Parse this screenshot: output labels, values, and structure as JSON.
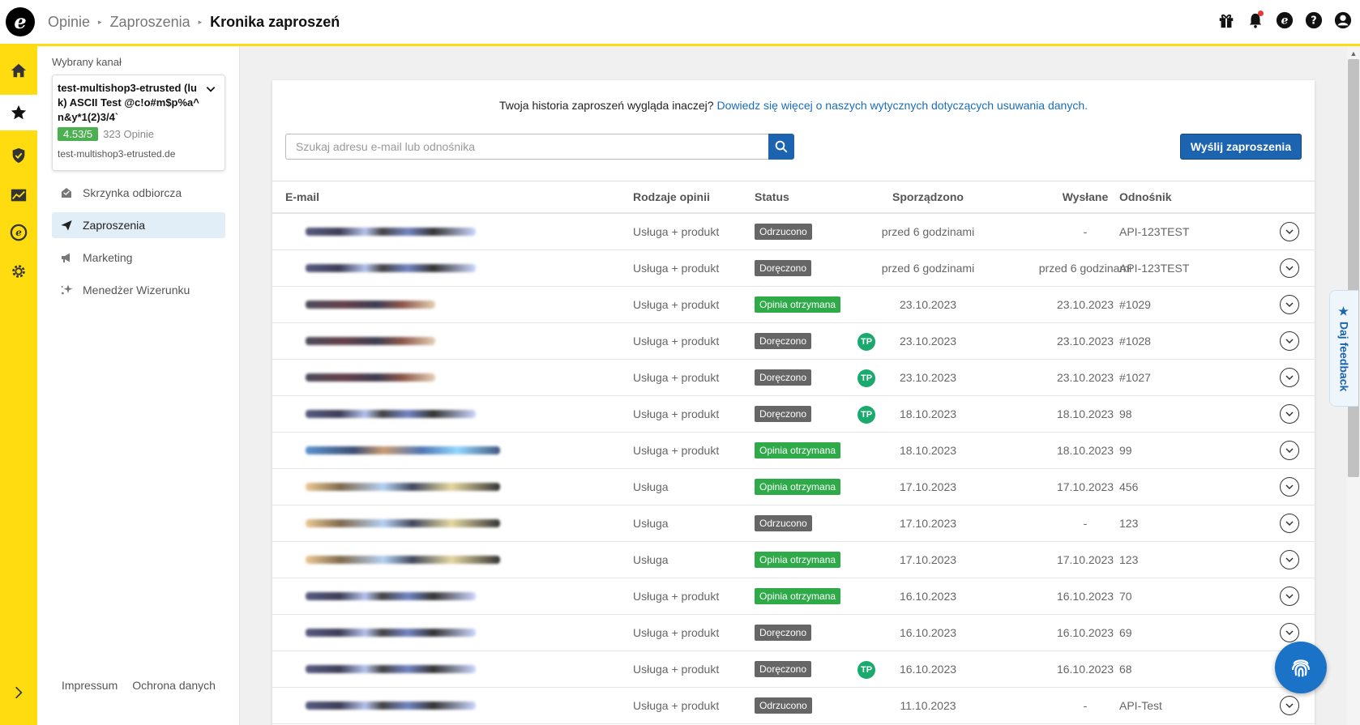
{
  "header": {
    "breadcrumbs": [
      "Opinie",
      "Zaproszenia",
      "Kronika zaproszeń"
    ],
    "logo_letter": "e"
  },
  "sidepanel": {
    "label": "Wybrany kanał",
    "channel": {
      "name": "test-multishop3-etrusted (luk) ASCII Test @c!o#m$p%a^n&y*1(2)3/4`",
      "rating": "4.53/5",
      "review_count": "323 Opinie",
      "url": "test-multishop3-etrusted.de"
    },
    "nav": [
      {
        "label": "Skrzynka odbiorcza",
        "icon": "inbox-icon"
      },
      {
        "label": "Zaproszenia",
        "icon": "paper-plane-icon"
      },
      {
        "label": "Marketing",
        "icon": "megaphone-icon"
      },
      {
        "label": "Menedżer Wizerunku",
        "icon": "sparkles-icon"
      }
    ],
    "footer": [
      "Impressum",
      "Ochrona danych"
    ]
  },
  "main": {
    "notice_text": "Twoja historia zaproszeń wygląda inaczej?",
    "notice_link": "Dowiedz się więcej o naszych wytycznych dotyczących usuwania danych.",
    "search_placeholder": "Szukaj adresu e-mail lub odnośnika",
    "send_button": "Wyślij zaproszenia",
    "columns": [
      "E-mail",
      "Rodzaje opinii",
      "Status",
      "Sporządzono",
      "Wysłane",
      "Odnośnik"
    ],
    "rows": [
      {
        "type": "Usługa + produkt",
        "status": "Odrzucono",
        "status_color": "grey",
        "tp": false,
        "created": "przed 6 godzinami",
        "sent": "-",
        "ref": "API-123TEST",
        "blur": ""
      },
      {
        "type": "Usługa + produkt",
        "status": "Doręczono",
        "status_color": "grey",
        "tp": false,
        "created": "przed 6 godzinami",
        "sent": "przed 6 godzinami",
        "ref": "API-123TEST",
        "blur": ""
      },
      {
        "type": "Usługa + produkt",
        "status": "Opinia otrzymana",
        "status_color": "green",
        "tp": false,
        "created": "23.10.2023",
        "sent": "23.10.2023",
        "ref": "#1029",
        "blur": "short"
      },
      {
        "type": "Usługa + produkt",
        "status": "Doręczono",
        "status_color": "grey",
        "tp": true,
        "created": "23.10.2023",
        "sent": "23.10.2023",
        "ref": "#1028",
        "blur": "short"
      },
      {
        "type": "Usługa + produkt",
        "status": "Doręczono",
        "status_color": "grey",
        "tp": true,
        "created": "23.10.2023",
        "sent": "23.10.2023",
        "ref": "#1027",
        "blur": "short"
      },
      {
        "type": "Usługa + produkt",
        "status": "Doręczono",
        "status_color": "grey",
        "tp": true,
        "created": "18.10.2023",
        "sent": "18.10.2023",
        "ref": "98",
        "blur": ""
      },
      {
        "type": "Usługa + produkt",
        "status": "Opinia otrzymana",
        "status_color": "green",
        "tp": false,
        "created": "18.10.2023",
        "sent": "18.10.2023",
        "ref": "99",
        "blur": "long"
      },
      {
        "type": "Usługa",
        "status": "Opinia otrzymana",
        "status_color": "green",
        "tp": false,
        "created": "17.10.2023",
        "sent": "17.10.2023",
        "ref": "456",
        "blur": "gold"
      },
      {
        "type": "Usługa",
        "status": "Odrzucono",
        "status_color": "grey",
        "tp": false,
        "created": "17.10.2023",
        "sent": "-",
        "ref": "123",
        "blur": "gold"
      },
      {
        "type": "Usługa",
        "status": "Opinia otrzymana",
        "status_color": "green",
        "tp": false,
        "created": "17.10.2023",
        "sent": "17.10.2023",
        "ref": "123",
        "blur": "gold"
      },
      {
        "type": "Usługa + produkt",
        "status": "Opinia otrzymana",
        "status_color": "green",
        "tp": false,
        "created": "16.10.2023",
        "sent": "16.10.2023",
        "ref": "70",
        "blur": ""
      },
      {
        "type": "Usługa + produkt",
        "status": "Doręczono",
        "status_color": "grey",
        "tp": false,
        "created": "16.10.2023",
        "sent": "16.10.2023",
        "ref": "69",
        "blur": ""
      },
      {
        "type": "Usługa + produkt",
        "status": "Doręczono",
        "status_color": "grey",
        "tp": true,
        "created": "16.10.2023",
        "sent": "16.10.2023",
        "ref": "68",
        "blur": ""
      },
      {
        "type": "Usługa + produkt",
        "status": "Odrzucono",
        "status_color": "grey",
        "tp": false,
        "created": "11.10.2023",
        "sent": "-",
        "ref": "API-Test",
        "blur": ""
      }
    ],
    "tp_label": "TP"
  },
  "feedback_tab": "★ Daj feedback",
  "colors": {
    "brand_yellow": "#ffdc0f",
    "primary_blue": "#1c64b0",
    "status_green": "#2eaa48",
    "status_grey": "#666666",
    "tp_green": "#1aaa6e"
  }
}
